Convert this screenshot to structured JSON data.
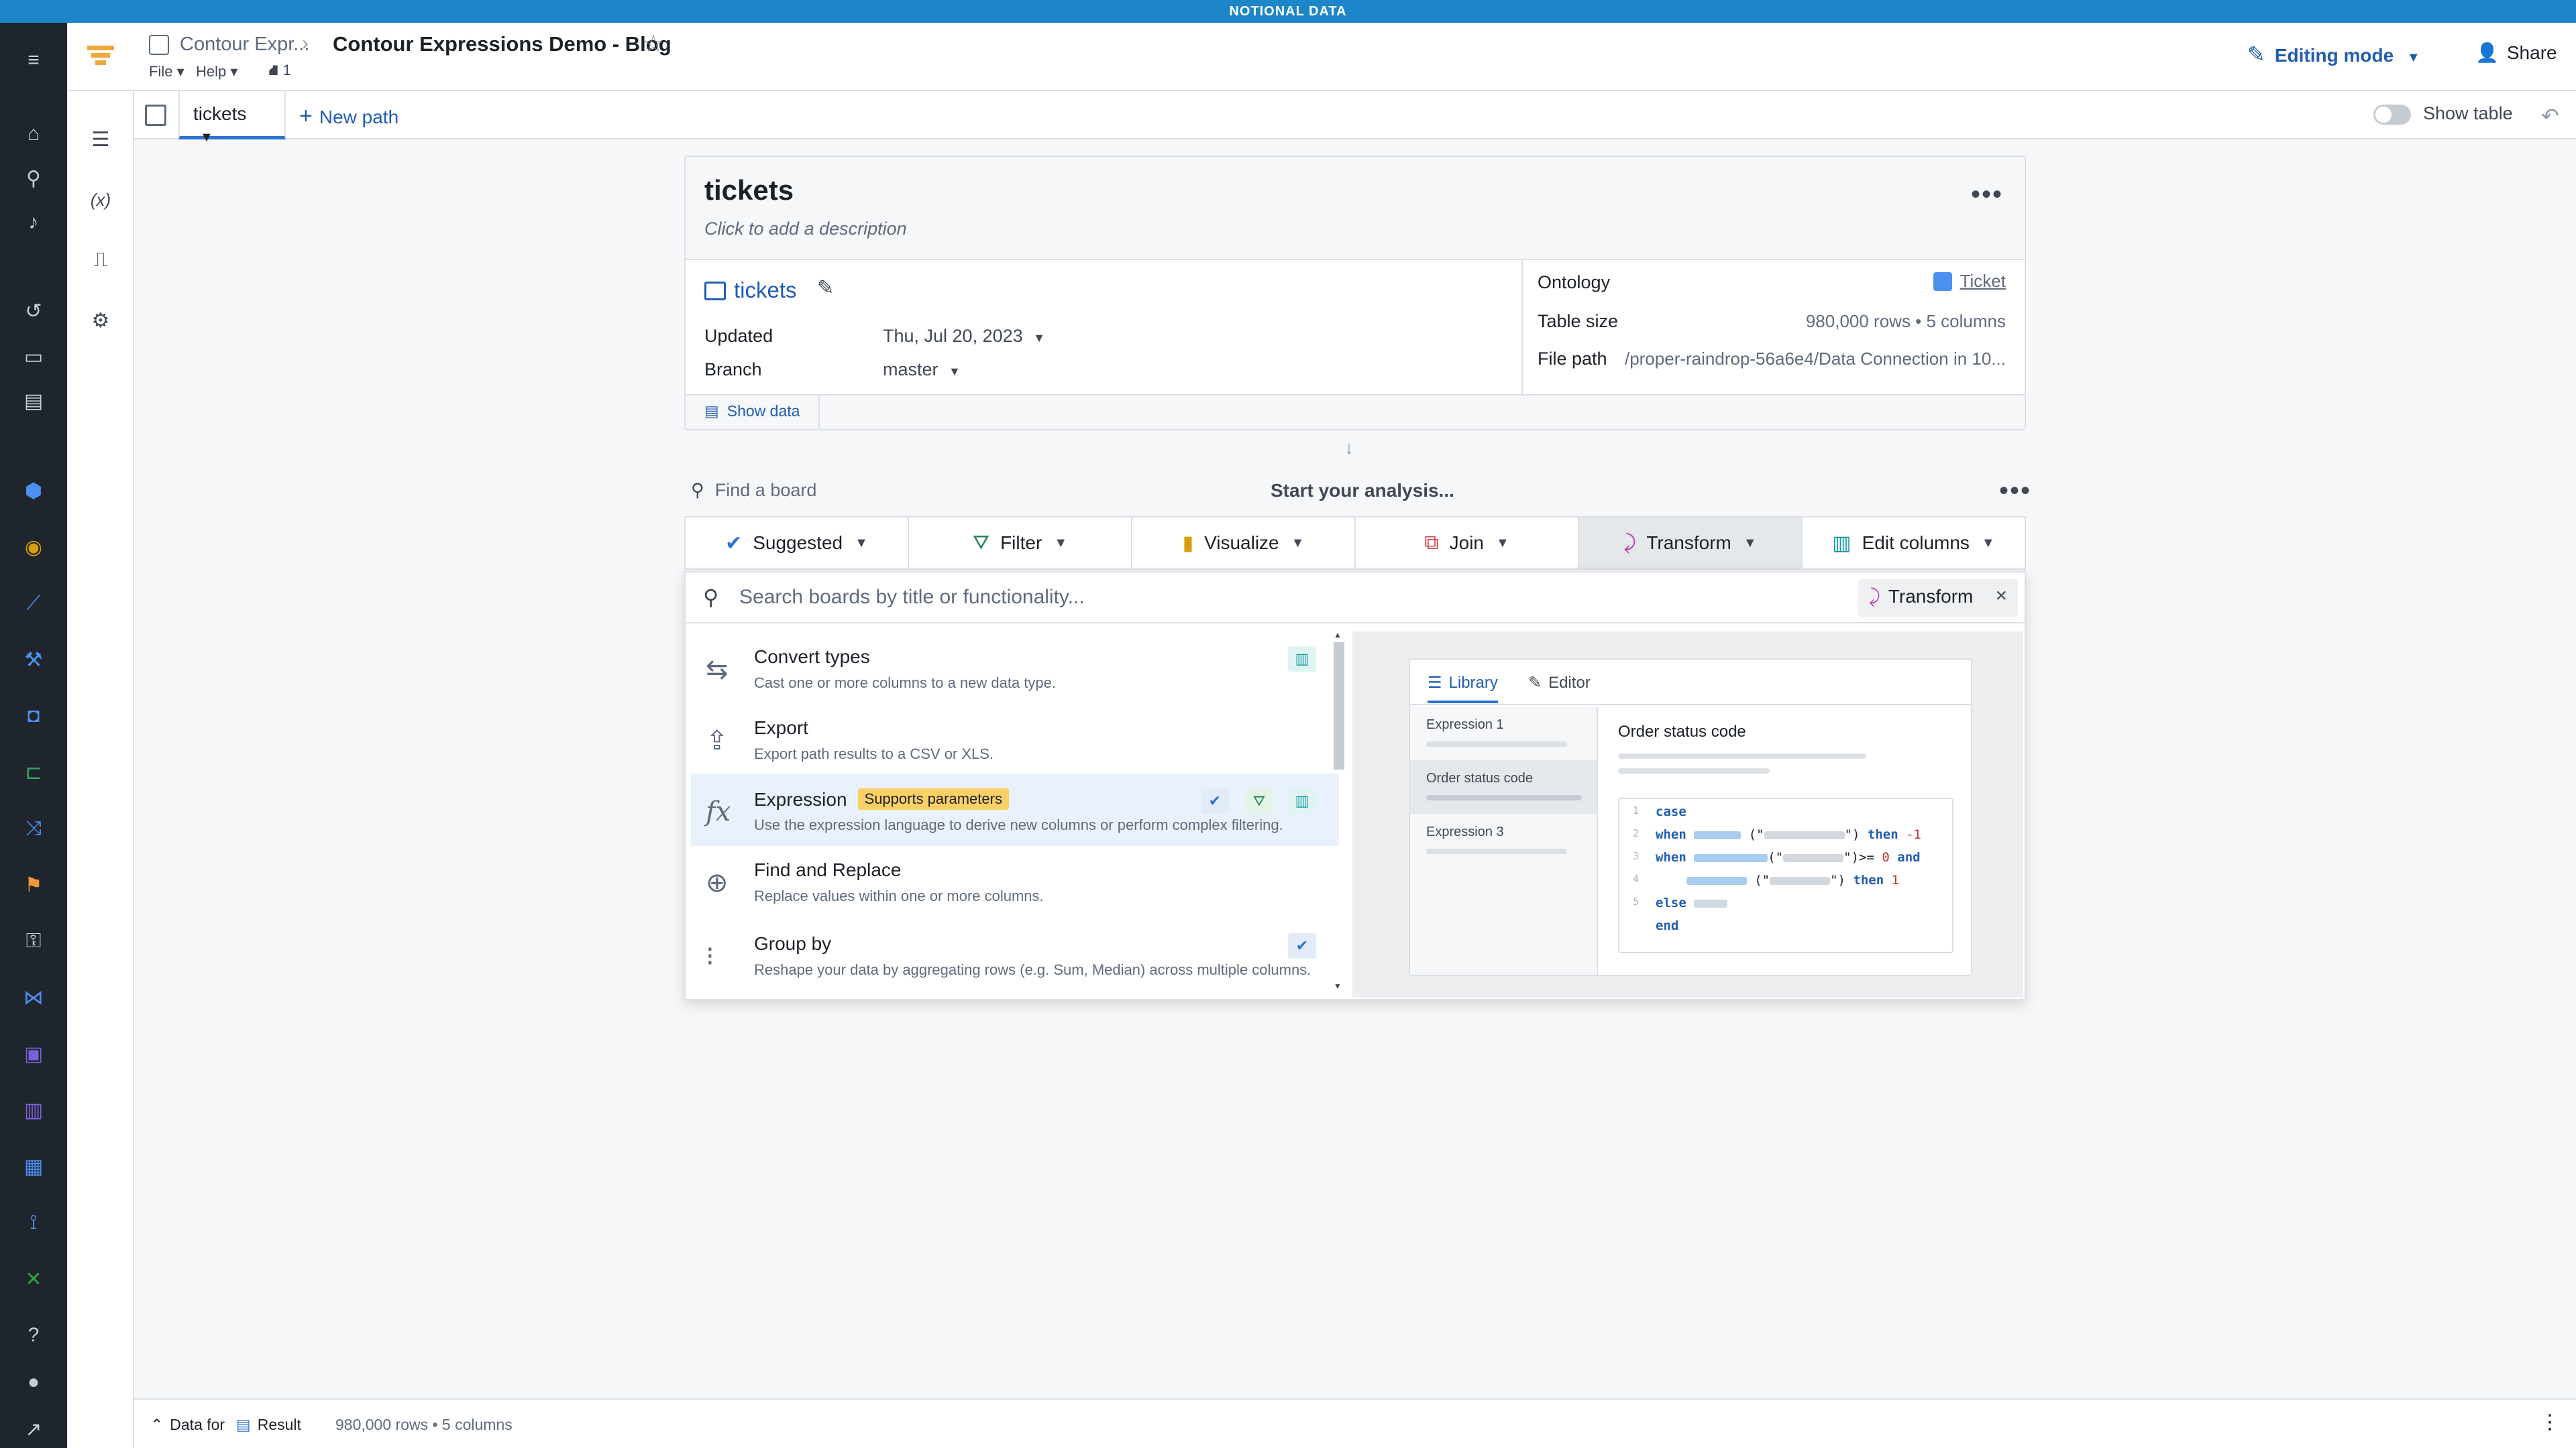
{
  "banner": "NOTIONAL DATA",
  "header": {
    "crumb_parent": "Contour Expr...",
    "title": "Contour Expressions Demo - Blog",
    "menu_file": "File",
    "menu_help": "Help",
    "resource_count": "1",
    "editing_mode": "Editing mode",
    "share": "Share"
  },
  "tabs": {
    "active": "tickets",
    "new_path": "New path",
    "show_table": "Show table"
  },
  "dataset": {
    "title": "tickets",
    "description_placeholder": "Click to add a description",
    "name": "tickets",
    "updated_label": "Updated",
    "updated_value": "Thu, Jul 20, 2023",
    "branch_label": "Branch",
    "branch_value": "master",
    "ontology_label": "Ontology",
    "ontology_value": "Ticket",
    "size_label": "Table size",
    "size_value": "980,000 rows • 5 columns",
    "path_label": "File path",
    "path_value": "/proper-raindrop-56a6e4/Data Connection in 10...",
    "show_data": "Show data"
  },
  "analysis": {
    "find_board": "Find a board",
    "start": "Start your analysis...",
    "categories": [
      "Suggested",
      "Filter",
      "Visualize",
      "Join",
      "Transform",
      "Edit columns"
    ],
    "search_placeholder": "Search boards by title or functionality...",
    "filter_chip": "Transform"
  },
  "boards": [
    {
      "title": "Convert types",
      "desc": "Cast one or more columns to a new data type."
    },
    {
      "title": "Export",
      "desc": "Export path results to a CSV or XLS."
    },
    {
      "title": "Expression",
      "badge": "Supports parameters",
      "desc": "Use the expression language to derive new columns or perform complex filtering."
    },
    {
      "title": "Find and Replace",
      "desc": "Replace values within one or more columns."
    },
    {
      "title": "Group by",
      "desc": "Reshape your data by aggregating rows (e.g. Sum, Median) across multiple columns."
    }
  ],
  "preview": {
    "tab_library": "Library",
    "tab_editor": "Editor",
    "expressions": [
      "Expression 1",
      "Order status code",
      "Expression 3"
    ],
    "main_title": "Order status code",
    "code": {
      "l1": "case",
      "l2_kw": "when",
      "l2_then": "then",
      "l2_val": "-1",
      "l3_kw": "when",
      "l3_op": ")>=",
      "l3_num": "0",
      "l3_and": "and",
      "l4_then": "then",
      "l4_val": "1",
      "l5": "else",
      "l6": "end"
    },
    "line_numbers": [
      "1",
      "2",
      "3",
      "4",
      "5"
    ]
  },
  "footer": {
    "data_for": "Data for",
    "result": "Result",
    "stats": "980,000 rows • 5 columns"
  }
}
